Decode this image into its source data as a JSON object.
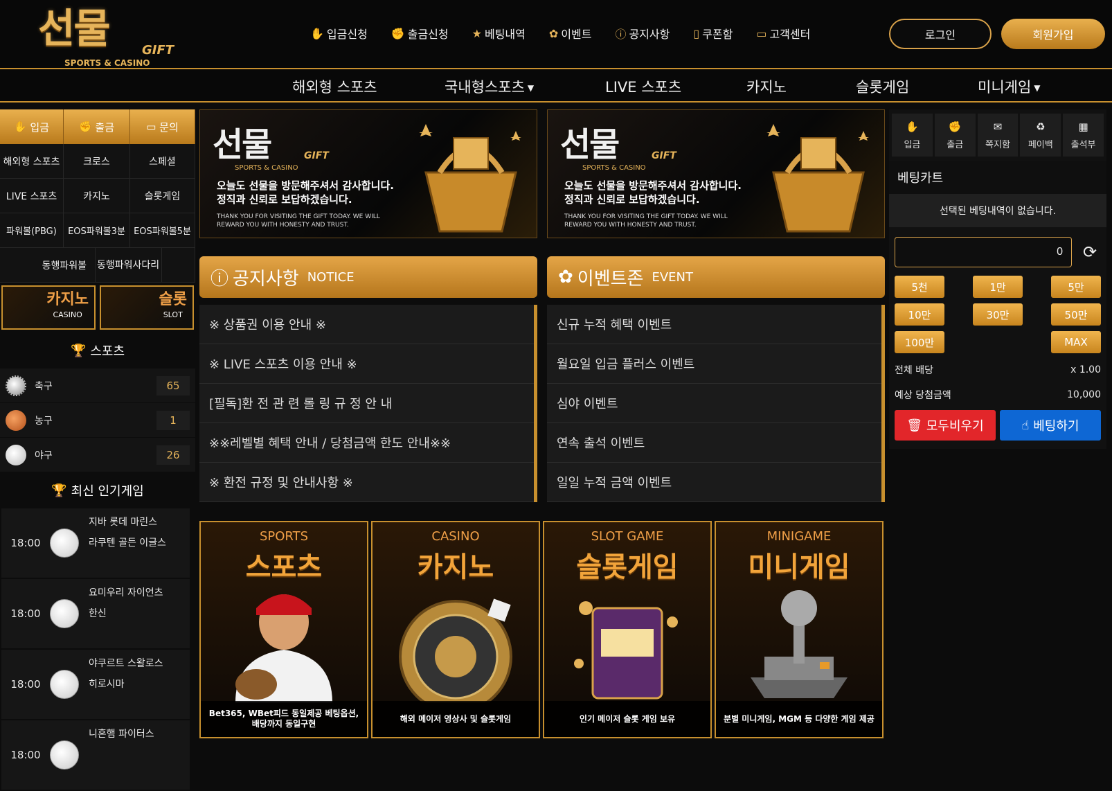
{
  "brand": {
    "logo_main": "선물",
    "logo_gift": "GIFT",
    "logo_sub": "SPORTS & CASINO"
  },
  "topmenu": [
    {
      "label": "입금신청",
      "icon": "deposit-icon"
    },
    {
      "label": "출금신청",
      "icon": "withdraw-icon"
    },
    {
      "label": "베팅내역",
      "icon": "betting-history-icon"
    },
    {
      "label": "이벤트",
      "icon": "gift-icon"
    },
    {
      "label": "공지사항",
      "icon": "notice-icon"
    },
    {
      "label": "쿠폰함",
      "icon": "coupon-icon"
    },
    {
      "label": "고객센터",
      "icon": "chat-icon"
    }
  ],
  "auth": {
    "login": "로그인",
    "join": "회원가입"
  },
  "catnav": [
    "해외형 스포츠",
    "국내형스포츠",
    "LIVE 스포츠",
    "카지노",
    "슬롯게임",
    "미니게임"
  ],
  "left": {
    "quick": [
      "입금",
      "출금",
      "문의"
    ],
    "grid": [
      [
        "해외형 스포츠",
        "크로스",
        "스페셜"
      ],
      [
        "LIVE 스포츠",
        "카지노",
        "슬롯게임"
      ],
      [
        "파워볼(PBG)",
        "EOS파워볼3분",
        "EOS파워볼5분"
      ]
    ],
    "row4": [
      "동행파워볼",
      "동행파워사다리"
    ],
    "banner_casino": {
      "kr": "카지노",
      "en": "CASINO"
    },
    "banner_slot": {
      "kr": "슬롯",
      "en": "SLOT"
    },
    "sports_title": "스포츠",
    "sports": [
      {
        "name": "축구",
        "count": "65"
      },
      {
        "name": "농구",
        "count": "1"
      },
      {
        "name": "야구",
        "count": "26"
      }
    ],
    "popular_title": "최신 인기게임",
    "games": [
      {
        "time": "18:00",
        "home": "지바 롯데 마린스",
        "away": "라쿠텐 골든 이글스"
      },
      {
        "time": "18:00",
        "home": "요미우리 자이언츠",
        "away": "한신"
      },
      {
        "time": "18:00",
        "home": "야쿠르트 스왈로스",
        "away": "히로시마"
      },
      {
        "time": "18:00",
        "home": "니혼햄 파이터스",
        "away": ""
      }
    ]
  },
  "topbanner": {
    "logo": "선물",
    "gift": "GIFT",
    "sub": "SPORTS & CASINO",
    "line1": "오늘도 선물을 방문해주셔서 감사합니다.",
    "line2": "정직과 신뢰로 보답하겠습니다.",
    "line3": "THANK YOU FOR VISITING THE GIFT TODAY. WE WILL REWARD YOU WITH HONESTY AND TRUST."
  },
  "notice": {
    "title": "공지사항",
    "en": "NOTICE",
    "items": [
      "※ 상품권 이용 안내 ※",
      "※ LIVE 스포츠 이용 안내 ※",
      "[필독]환 전 관 련 롤 링 규 정 안 내",
      "※※레벨별 혜택 안내 / 당첨금액 한도 안내※※",
      "※ 환전 규정 및 안내사항 ※"
    ]
  },
  "event": {
    "title": "이벤트존",
    "en": "EVENT",
    "items": [
      "신규 누적 혜택 이벤트",
      "월요일 입금 플러스 이벤트",
      "심야 이벤트",
      "연속 출석 이벤트",
      "일일 누적 금액 이벤트"
    ]
  },
  "promos": [
    {
      "en": "SPORTS",
      "kr": "스포츠",
      "desc": "Bet365, WBet피드 동일제공 베팅옵션, 배당까지 동일구현"
    },
    {
      "en": "CASINO",
      "kr": "카지노",
      "desc": "해외 메이저 영상사 및 슬롯게임"
    },
    {
      "en": "SLOT GAME",
      "kr": "슬롯게임",
      "desc": "인기 메이저 슬롯 게임 보유"
    },
    {
      "en": "MINIGAME",
      "kr": "미니게임",
      "desc": "분별 미니게임, MGM 등 다양한 게임 제공"
    }
  ],
  "right": {
    "tabs": [
      "입금",
      "출금",
      "쪽지함",
      "페이백",
      "출석부"
    ],
    "cart_title": "베팅카트",
    "cart_empty": "선택된 베팅내역이 없습니다.",
    "amount": "0",
    "chips": [
      "5천",
      "1만",
      "5만",
      "10만",
      "30만",
      "50만",
      "100만",
      "MAX"
    ],
    "total_odds_label": "전체 배당",
    "total_odds_value": "x 1.00",
    "expected_label": "예상 당첨금액",
    "expected_value": "10,000",
    "clear": "모두비우기",
    "bet": "베팅하기"
  },
  "colors": {
    "gold": "#c8902e",
    "bet_blue": "#0e67d4",
    "clear_red": "#e2262a"
  }
}
